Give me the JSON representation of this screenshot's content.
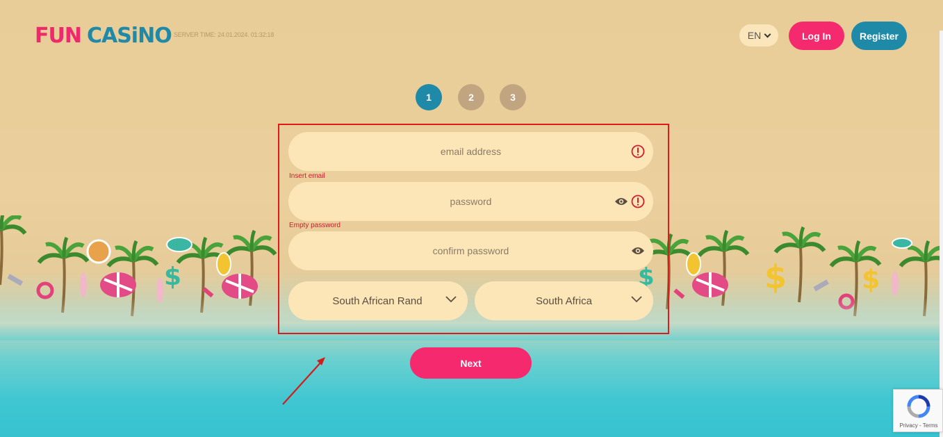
{
  "header": {
    "logo_fun": "FUN",
    "logo_casino": "CASiNO",
    "server_time": "SERVER TIME: 24.01.2024. 01:32:18",
    "language": "EN",
    "login_label": "Log In",
    "register_label": "Register"
  },
  "steps": [
    "1",
    "2",
    "3"
  ],
  "current_step": 1,
  "form": {
    "email_placeholder": "email address",
    "email_error": "Insert email",
    "password_placeholder": "password",
    "password_error": "Empty password",
    "confirm_placeholder": "confirm password",
    "currency": "South African Rand",
    "country": "South Africa",
    "next_label": "Next"
  },
  "recaptcha": {
    "links": "Privacy - Terms"
  },
  "colors": {
    "brand_pink": "#f5296e",
    "brand_teal": "#1e8aa8",
    "field_bg": "#fce6b8",
    "error_red": "#d11c2c",
    "annotation_red": "#e01a1a"
  }
}
